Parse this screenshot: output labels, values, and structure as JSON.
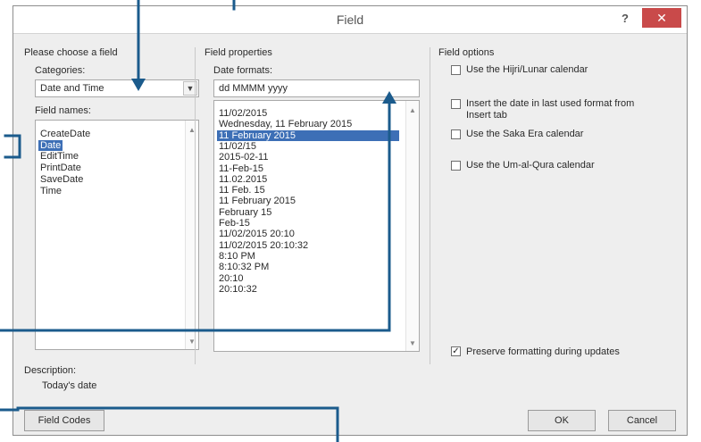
{
  "dialog": {
    "title": "Field",
    "help": "?",
    "close": "✕"
  },
  "left_panel": {
    "heading": "Please choose a field",
    "categories_label": "Categories:",
    "categories_value": "Date and Time",
    "field_names_label": "Field names:",
    "field_names": [
      "CreateDate",
      "Date",
      "EditTime",
      "PrintDate",
      "SaveDate",
      "Time"
    ],
    "selected_field": "Date",
    "description_label": "Description:",
    "description_text": "Today's date"
  },
  "middle_panel": {
    "heading": "Field properties",
    "date_formats_label": "Date formats:",
    "date_format_value": "dd MMMM yyyy",
    "formats": [
      "11/02/2015",
      "Wednesday, 11 February 2015",
      "11 February 2015",
      "11/02/15",
      "2015-02-11",
      "11-Feb-15",
      "11.02.2015",
      "11 Feb. 15",
      "11 February 2015",
      "February 15",
      "Feb-15",
      "11/02/2015 20:10",
      "11/02/2015 20:10:32",
      "8:10 PM",
      "8:10:32 PM",
      "20:10",
      "20:10:32"
    ],
    "selected_format": "11 February 2015"
  },
  "right_panel": {
    "heading": "Field options",
    "options": [
      {
        "label": "Use the Hijri/Lunar calendar",
        "checked": false
      },
      {
        "label": "Insert the date in last used format from",
        "label2": "Insert tab",
        "checked": false
      },
      {
        "label": "Use the Saka Era calendar",
        "checked": false
      },
      {
        "label": "Use the Um-al-Qura calendar",
        "checked": false
      }
    ],
    "preserve_label": "Preserve formatting during updates",
    "preserve_checked": true
  },
  "buttons": {
    "field_codes": "Field Codes",
    "ok": "OK",
    "cancel": "Cancel"
  },
  "colors": {
    "callout": "#1b5b8c",
    "selection": "#3d6fb6",
    "close_button": "#c94a4a"
  },
  "icons": {
    "combo_arrow": "chevron-down-icon",
    "checkmark": "checkmark-icon"
  }
}
